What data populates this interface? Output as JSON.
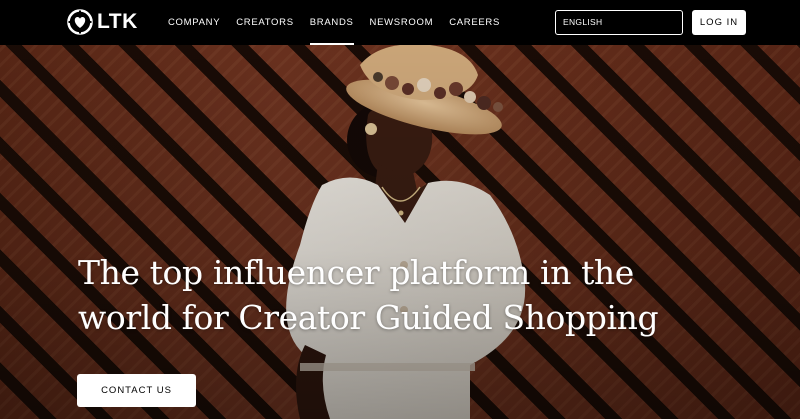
{
  "brand": {
    "logo_text": "LTK"
  },
  "nav": {
    "items": [
      {
        "label": "COMPANY"
      },
      {
        "label": "CREATORS"
      },
      {
        "label": "BRANDS"
      },
      {
        "label": "NEWSROOM"
      },
      {
        "label": "CAREERS"
      }
    ],
    "active": "BRANDS"
  },
  "header": {
    "language": "ENGLISH",
    "login_label": "LOG IN"
  },
  "hero": {
    "headline": "The top influencer platform in the world for Creator Guided Shopping",
    "cta_label": "CONTACT US"
  },
  "colors": {
    "header_bg": "#000000",
    "button_bg": "#ffffff",
    "wood": "#6e3320"
  }
}
